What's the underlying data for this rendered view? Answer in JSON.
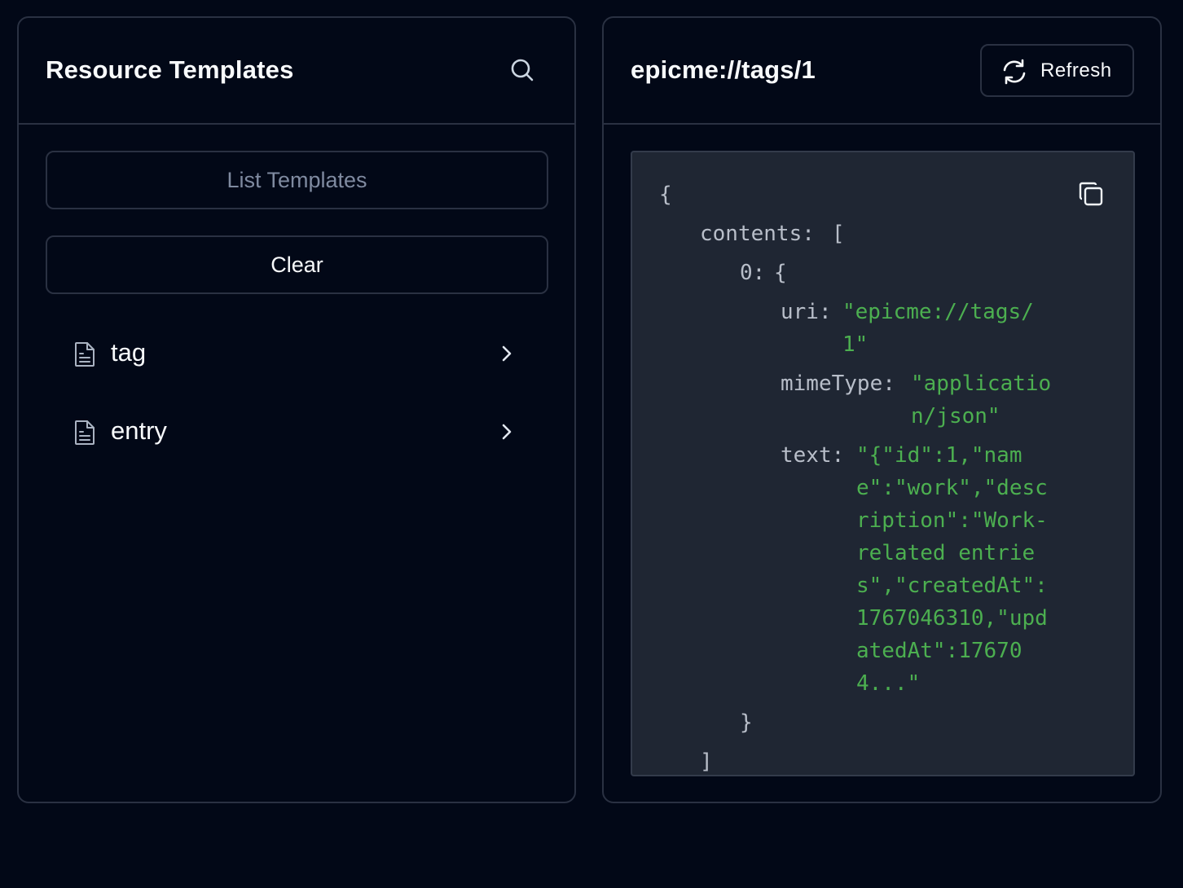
{
  "left_panel": {
    "title": "Resource Templates",
    "list_button": "List Templates",
    "clear_button": "Clear",
    "templates": [
      {
        "label": "tag"
      },
      {
        "label": "entry"
      }
    ]
  },
  "right_panel": {
    "title": "epicme://tags/1",
    "refresh_button": "Refresh",
    "json": {
      "open_brace": "{",
      "contents_key": "contents:",
      "contents_open": "[",
      "index_key": "0:",
      "index_open": "{",
      "uri_key": "uri:",
      "uri_line1": "\"epicme://tags/",
      "uri_line2": "1\"",
      "mime_key": "mimeType:",
      "mime_line1": "\"applicatio",
      "mime_line2": "n/json\"",
      "text_key": "text:",
      "text_lines": [
        "\"{\"id\":1,\"nam",
        "e\":\"work\",\"desc",
        "ription\":\"Work-",
        "related entrie",
        "s\",\"createdAt\":",
        "1767046310,\"upd",
        "atedAt\":17670",
        "4...\""
      ],
      "index_close": "}",
      "contents_close": "]"
    }
  },
  "colors": {
    "background": "#020817",
    "border": "#2a3142",
    "code_background": "#1f2633",
    "string": "#4caf50",
    "key": "#b8bec9"
  }
}
